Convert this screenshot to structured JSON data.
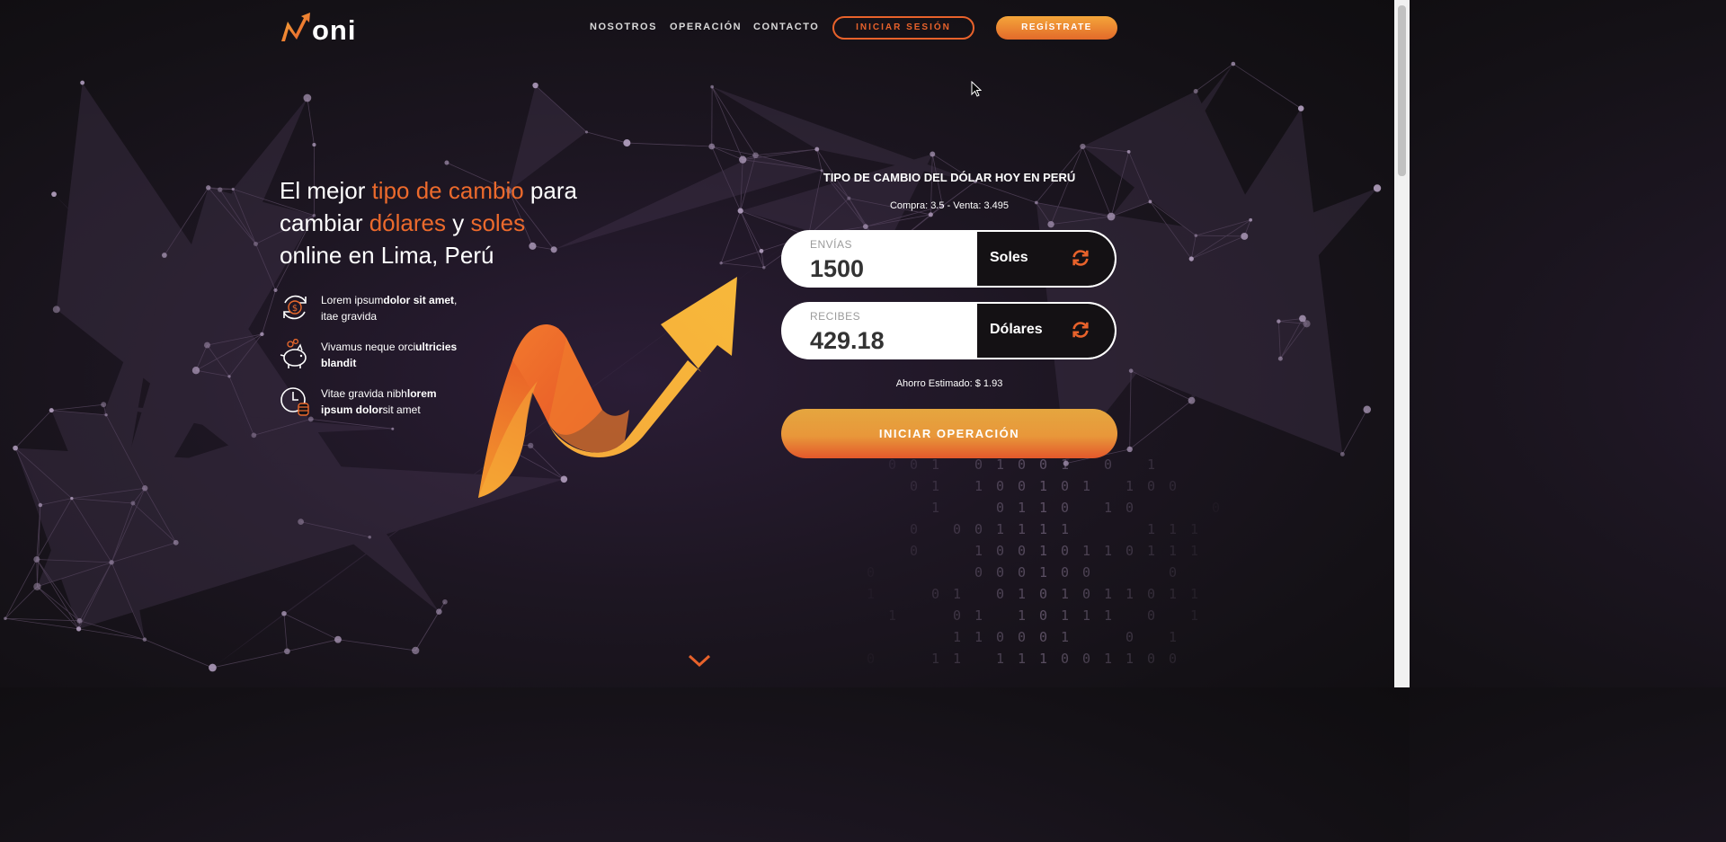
{
  "brand": {
    "logo_text": "oni",
    "accent": "#ec6a2c",
    "accent_light": "#f4a53a"
  },
  "nav": {
    "items": [
      "NOSOTROS",
      "OPERACIÓN",
      "CONTACTO"
    ],
    "login_label": "INICIAR SESIÓN",
    "register_label": "REGÍSTRATE"
  },
  "hero": {
    "t1": "El mejor ",
    "t2": "tipo de cambio",
    "t3": " para",
    "t4": "cambiar ",
    "t5": "dólares",
    "t6": " y ",
    "t7": "soles",
    "t8": "online en Lima, Perú",
    "features": [
      {
        "icon": "dollar-exchange-icon",
        "a": "Lorem ipsum",
        "b": "dolor sit amet",
        "c": ", itae gravida"
      },
      {
        "icon": "piggy-bank-icon",
        "a": "Vivamus neque orci",
        "b": "ultricies blandit",
        "c": ""
      },
      {
        "icon": "clock-coins-icon",
        "a": "Vitae gravida nibh",
        "b": "lorem ipsum dolor",
        "c": "sit amet"
      }
    ]
  },
  "calculator": {
    "title": "TIPO DE CAMBIO DEL DÓLAR HOY EN PERÚ",
    "rate": "Compra: 3.5 - Venta: 3.495",
    "send_label": "ENVÍAS",
    "send_value": "1500",
    "send_currency": "Soles",
    "receive_label": "RECIBES",
    "receive_value": "429.18",
    "receive_currency": "Dólares",
    "savings": "Ahorro Estimado: $ 1.93",
    "cta": "INICIAR OPERACIÓN"
  }
}
